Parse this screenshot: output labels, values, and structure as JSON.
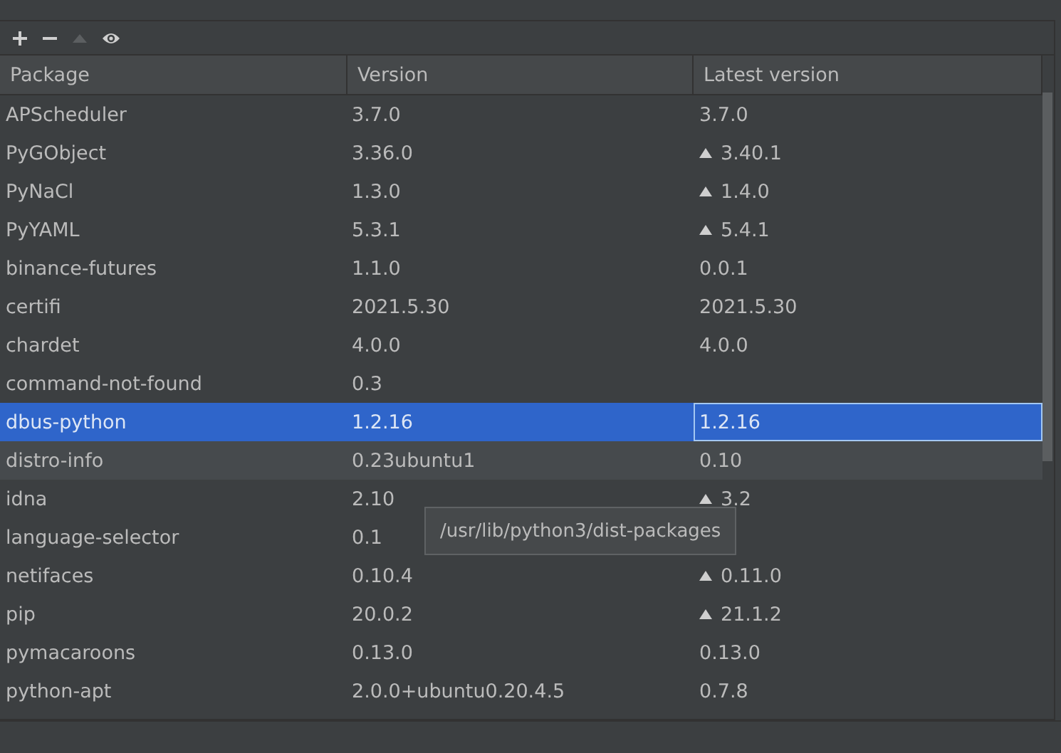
{
  "toolbar": [
    {
      "kind": "add",
      "disabled": false
    },
    {
      "kind": "remove",
      "disabled": false
    },
    {
      "kind": "upgrade",
      "disabled": true
    },
    {
      "kind": "show",
      "disabled": false
    }
  ],
  "table": {
    "columns": [
      "Package",
      "Version",
      "Latest version"
    ],
    "rows": [
      {
        "package": "APScheduler",
        "version": "3.7.0",
        "latest": "3.7.0",
        "upgrade": false,
        "selected": false,
        "hovered": false
      },
      {
        "package": "PyGObject",
        "version": "3.36.0",
        "latest": "3.40.1",
        "upgrade": true,
        "selected": false,
        "hovered": false
      },
      {
        "package": "PyNaCl",
        "version": "1.3.0",
        "latest": "1.4.0",
        "upgrade": true,
        "selected": false,
        "hovered": false
      },
      {
        "package": "PyYAML",
        "version": "5.3.1",
        "latest": "5.4.1",
        "upgrade": true,
        "selected": false,
        "hovered": false
      },
      {
        "package": "binance-futures",
        "version": "1.1.0",
        "latest": "0.0.1",
        "upgrade": false,
        "selected": false,
        "hovered": false
      },
      {
        "package": "certifi",
        "version": "2021.5.30",
        "latest": "2021.5.30",
        "upgrade": false,
        "selected": false,
        "hovered": false
      },
      {
        "package": "chardet",
        "version": "4.0.0",
        "latest": "4.0.0",
        "upgrade": false,
        "selected": false,
        "hovered": false
      },
      {
        "package": "command-not-found",
        "version": "0.3",
        "upgrade": false,
        "selected": false,
        "hovered": false
      },
      {
        "package": "dbus-python",
        "version": "1.2.16",
        "latest": "1.2.16",
        "upgrade": false,
        "selected": true,
        "hovered": false
      },
      {
        "package": "distro-info",
        "version": "0.23ubuntu1",
        "latest": "0.10",
        "upgrade": false,
        "selected": false,
        "hovered": true
      },
      {
        "package": "idna",
        "version": "2.10",
        "latest": "3.2",
        "upgrade": true,
        "selected": false,
        "hovered": false
      },
      {
        "package": "language-selector",
        "version": "0.1",
        "upgrade": false,
        "selected": false,
        "hovered": false
      },
      {
        "package": "netifaces",
        "version": "0.10.4",
        "latest": "0.11.0",
        "upgrade": true,
        "selected": false,
        "hovered": false
      },
      {
        "package": "pip",
        "version": "20.0.2",
        "latest": "21.1.2",
        "upgrade": true,
        "selected": false,
        "hovered": false
      },
      {
        "package": "pymacaroons",
        "version": "0.13.0",
        "latest": "0.13.0",
        "upgrade": false,
        "selected": false,
        "hovered": false
      },
      {
        "package": "python-apt",
        "version": "2.0.0+ubuntu0.20.4.5",
        "latest": "0.7.8",
        "upgrade": false,
        "selected": false,
        "hovered": false
      }
    ]
  },
  "tooltip": "/usr/lib/python3/dist-packages"
}
